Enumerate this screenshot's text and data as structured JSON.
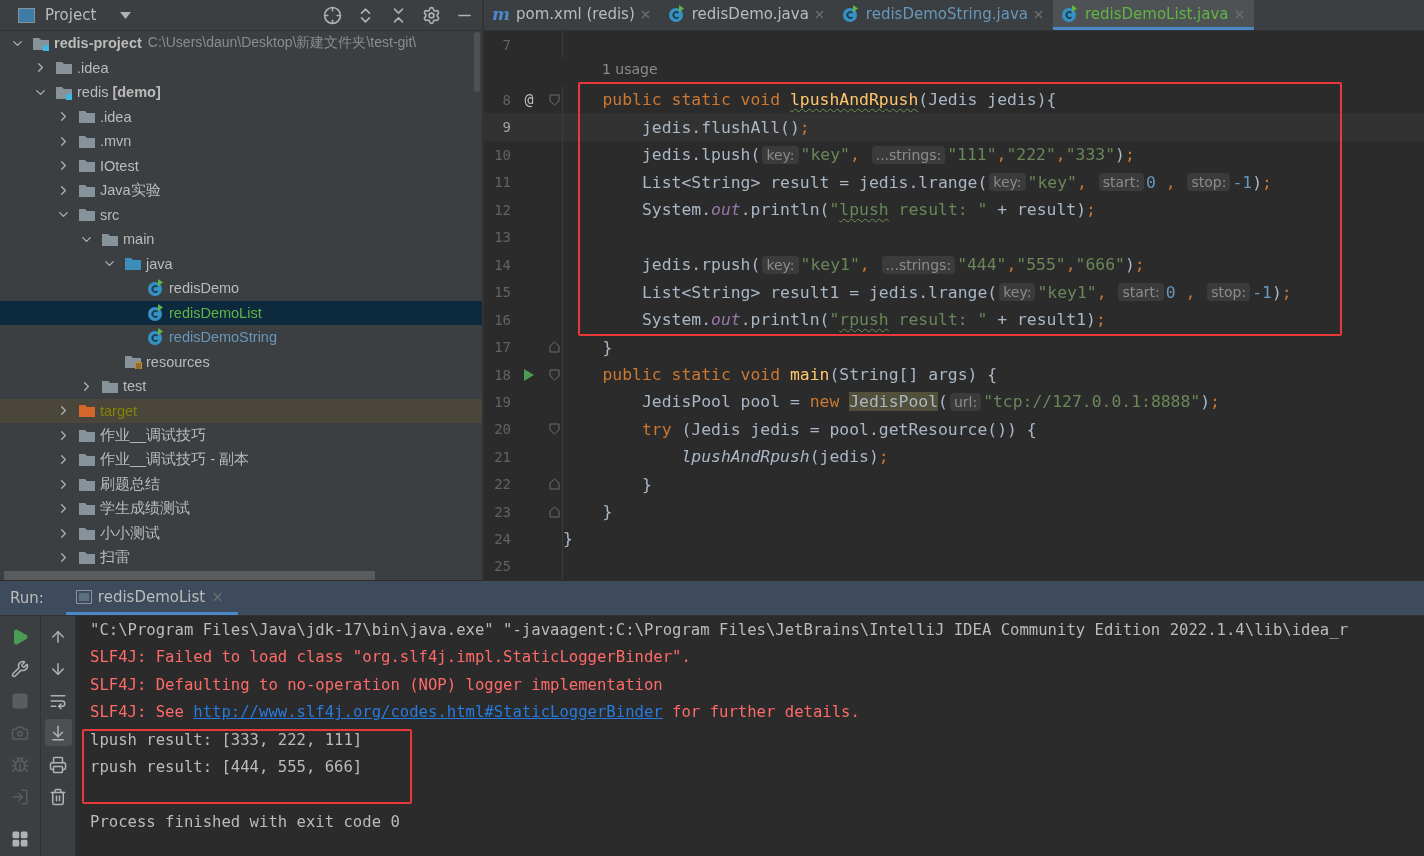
{
  "project_panel": {
    "title": "Project",
    "toolbar": [
      {
        "kind": "locate"
      },
      {
        "kind": "expand"
      },
      {
        "kind": "collapse"
      },
      {
        "kind": "settings"
      },
      {
        "kind": "hide"
      }
    ],
    "tree": [
      {
        "label": "redis-project",
        "kind": "project",
        "path": "C:\\Users\\daun\\Desktop\\新建文件夹\\test-git\\",
        "expanded": true,
        "selected": false,
        "color": "#bbbbbb",
        "children": [
          {
            "label": ".idea",
            "kind": "folder",
            "expanded": false,
            "selected": false,
            "color": "#bbbbbb"
          },
          {
            "label": "redis",
            "tag": "[demo]",
            "kind": "module",
            "expanded": true,
            "selected": false,
            "color": "#bbbbbb",
            "children": [
              {
                "label": ".idea",
                "kind": "folder",
                "expanded": false,
                "selected": false,
                "color": "#bbbbbb"
              },
              {
                "label": ".mvn",
                "kind": "folder",
                "expanded": false,
                "selected": false,
                "color": "#bbbbbb"
              },
              {
                "label": "IOtest",
                "kind": "folder",
                "expanded": false,
                "selected": false,
                "color": "#bbbbbb"
              },
              {
                "label": "Java实验",
                "kind": "folder",
                "expanded": false,
                "selected": false,
                "color": "#bbbbbb"
              },
              {
                "label": "src",
                "kind": "folder",
                "expanded": true,
                "selected": false,
                "color": "#bbbbbb",
                "children": [
                  {
                    "label": "main",
                    "kind": "folder",
                    "expanded": true,
                    "selected": false,
                    "color": "#bbbbbb",
                    "children": [
                      {
                        "label": "java",
                        "kind": "source",
                        "expanded": true,
                        "selected": false,
                        "color": "#bbbbbb",
                        "children": [
                          {
                            "label": "redisDemo",
                            "kind": "class",
                            "selected": false,
                            "color": "#bbbbbb"
                          },
                          {
                            "label": "redisDemoList",
                            "kind": "class",
                            "selected": true,
                            "color": "#62b543"
                          },
                          {
                            "label": "redisDemoString",
                            "kind": "class",
                            "selected": false,
                            "color": "#6897bb"
                          }
                        ]
                      },
                      {
                        "label": "resources",
                        "kind": "resources",
                        "selected": false,
                        "color": "#bbbbbb"
                      }
                    ]
                  },
                  {
                    "label": "test",
                    "kind": "folder",
                    "expanded": false,
                    "selected": false,
                    "color": "#bbbbbb"
                  }
                ]
              },
              {
                "label": "target",
                "kind": "excluded",
                "expanded": false,
                "selected": false,
                "color": "#848504"
              },
              {
                "label": "作业__调试技巧",
                "kind": "folder",
                "expanded": false,
                "selected": false,
                "color": "#bbbbbb"
              },
              {
                "label": "作业__调试技巧 - 副本",
                "kind": "folder",
                "expanded": false,
                "selected": false,
                "color": "#bbbbbb"
              },
              {
                "label": "刷题总结",
                "kind": "folder",
                "expanded": false,
                "selected": false,
                "color": "#bbbbbb"
              },
              {
                "label": "学生成绩测试",
                "kind": "folder",
                "expanded": false,
                "selected": false,
                "color": "#bbbbbb"
              },
              {
                "label": "小小测试",
                "kind": "folder",
                "expanded": false,
                "selected": false,
                "color": "#bbbbbb"
              },
              {
                "label": "扫雷",
                "kind": "folder",
                "expanded": false,
                "selected": false,
                "color": "#bbbbbb"
              }
            ]
          }
        ]
      }
    ]
  },
  "editor": {
    "tabs": [
      {
        "label": "pom.xml (redis)",
        "kind": "maven",
        "glyph": "m",
        "selected": false,
        "color": "#bbbbbb"
      },
      {
        "label": "redisDemo.java",
        "kind": "class",
        "selected": false,
        "color": "#bbbbbb"
      },
      {
        "label": "redisDemoString.java",
        "kind": "class",
        "selected": false,
        "color": "#6897bb"
      },
      {
        "label": "redisDemoList.java",
        "kind": "class",
        "selected": true,
        "color": "#62b543"
      }
    ],
    "lines": [
      {
        "number": "7",
        "current": false,
        "boxed": false
      },
      {
        "number": "8",
        "current": false,
        "boxed": true,
        "usage": "1 usage",
        "gutter": {
          "kind": "override",
          "glyph": "@"
        },
        "fold": {
          "kind": "open"
        },
        "tokens": [
          {
            "kind": "kw",
            "text": "    public static void "
          },
          {
            "kind": "decl",
            "text": "lpushAndRpush",
            "squiggle": true
          },
          {
            "kind": "plain",
            "text": "(Jedis jedis){"
          }
        ]
      },
      {
        "number": "9",
        "current": true,
        "boxed": true,
        "tokens": [
          {
            "kind": "plain",
            "text": "        jedis.flushAll()"
          },
          {
            "kind": "semi",
            "text": ";"
          }
        ]
      },
      {
        "number": "10",
        "current": false,
        "boxed": true,
        "tokens": [
          {
            "kind": "plain",
            "text": "        jedis.lpush("
          },
          {
            "kind": "hint",
            "text": "key:"
          },
          {
            "kind": "str",
            "text": "\"key\""
          },
          {
            "kind": "semi",
            "text": ", "
          },
          {
            "kind": "hint",
            "text": "...strings:"
          },
          {
            "kind": "str",
            "text": "\"111\""
          },
          {
            "kind": "semi",
            "text": ","
          },
          {
            "kind": "str",
            "text": "\"222\""
          },
          {
            "kind": "semi",
            "text": ","
          },
          {
            "kind": "str",
            "text": "\"333\""
          },
          {
            "kind": "plain",
            "text": ")"
          },
          {
            "kind": "semi",
            "text": ";"
          }
        ]
      },
      {
        "number": "11",
        "current": false,
        "boxed": true,
        "tokens": [
          {
            "kind": "plain",
            "text": "        List<String> result = jedis.lrange("
          },
          {
            "kind": "hint",
            "text": "key:"
          },
          {
            "kind": "str",
            "text": "\"key\""
          },
          {
            "kind": "semi",
            "text": ", "
          },
          {
            "kind": "hint",
            "text": "start:"
          },
          {
            "kind": "num",
            "text": "0"
          },
          {
            "kind": "semi",
            "text": " , "
          },
          {
            "kind": "hint",
            "text": "stop:"
          },
          {
            "kind": "num",
            "text": "-1"
          },
          {
            "kind": "plain",
            "text": ")"
          },
          {
            "kind": "semi",
            "text": ";"
          }
        ]
      },
      {
        "number": "12",
        "current": false,
        "boxed": true,
        "tokens": [
          {
            "kind": "plain",
            "text": "        System."
          },
          {
            "kind": "field",
            "text": "out"
          },
          {
            "kind": "plain",
            "text": ".println("
          },
          {
            "kind": "str",
            "text": "\""
          },
          {
            "kind": "str",
            "text": "lpush",
            "squiggle": true
          },
          {
            "kind": "str",
            "text": " result: \""
          },
          {
            "kind": "plain",
            "text": " + result)"
          },
          {
            "kind": "semi",
            "text": ";"
          }
        ]
      },
      {
        "number": "13",
        "current": false,
        "boxed": true
      },
      {
        "number": "14",
        "current": false,
        "boxed": true,
        "tokens": [
          {
            "kind": "plain",
            "text": "        jedis.rpush("
          },
          {
            "kind": "hint",
            "text": "key:"
          },
          {
            "kind": "str",
            "text": "\"key1\""
          },
          {
            "kind": "semi",
            "text": ", "
          },
          {
            "kind": "hint",
            "text": "...strings:"
          },
          {
            "kind": "str",
            "text": "\"444\""
          },
          {
            "kind": "semi",
            "text": ","
          },
          {
            "kind": "str",
            "text": "\"555\""
          },
          {
            "kind": "semi",
            "text": ","
          },
          {
            "kind": "str",
            "text": "\"666\""
          },
          {
            "kind": "plain",
            "text": ")"
          },
          {
            "kind": "semi",
            "text": ";"
          }
        ]
      },
      {
        "number": "15",
        "current": false,
        "boxed": true,
        "tokens": [
          {
            "kind": "plain",
            "text": "        List<String> result1 = jedis.lrange("
          },
          {
            "kind": "hint",
            "text": "key:"
          },
          {
            "kind": "str",
            "text": "\"key1\""
          },
          {
            "kind": "semi",
            "text": ", "
          },
          {
            "kind": "hint",
            "text": "start:"
          },
          {
            "kind": "num",
            "text": "0"
          },
          {
            "kind": "semi",
            "text": " , "
          },
          {
            "kind": "hint",
            "text": "stop:"
          },
          {
            "kind": "num",
            "text": "-1"
          },
          {
            "kind": "plain",
            "text": ")"
          },
          {
            "kind": "semi",
            "text": ";"
          }
        ]
      },
      {
        "number": "16",
        "current": false,
        "boxed": true,
        "tokens": [
          {
            "kind": "plain",
            "text": "        System."
          },
          {
            "kind": "field",
            "text": "out"
          },
          {
            "kind": "plain",
            "text": ".println("
          },
          {
            "kind": "str",
            "text": "\""
          },
          {
            "kind": "str",
            "text": "rpush",
            "squiggle": true
          },
          {
            "kind": "str",
            "text": " result: \""
          },
          {
            "kind": "plain",
            "text": " + result1)"
          },
          {
            "kind": "semi",
            "text": ";"
          }
        ]
      },
      {
        "number": "17",
        "current": false,
        "boxed": false,
        "fold": {
          "kind": "close"
        },
        "tokens": [
          {
            "kind": "plain",
            "text": "    }"
          }
        ]
      },
      {
        "number": "18",
        "current": false,
        "boxed": false,
        "gutter": {
          "kind": "run"
        },
        "fold": {
          "kind": "open"
        },
        "tokens": [
          {
            "kind": "kw",
            "text": "    public static void "
          },
          {
            "kind": "decl",
            "text": "main"
          },
          {
            "kind": "plain",
            "text": "(String[] args) {"
          }
        ]
      },
      {
        "number": "19",
        "current": false,
        "boxed": false,
        "tokens": [
          {
            "kind": "plain",
            "text": "        JedisPool pool = "
          },
          {
            "kind": "kw",
            "text": "new "
          },
          {
            "kind": "match",
            "text": "JedisPool"
          },
          {
            "kind": "plain",
            "text": "("
          },
          {
            "kind": "hint",
            "text": "url:"
          },
          {
            "kind": "str",
            "text": "\"tcp://127.0.0.1:8888\""
          },
          {
            "kind": "plain",
            "text": ")"
          },
          {
            "kind": "semi",
            "text": ";"
          }
        ]
      },
      {
        "number": "20",
        "current": false,
        "boxed": false,
        "fold": {
          "kind": "open"
        },
        "tokens": [
          {
            "kind": "kw",
            "text": "        try "
          },
          {
            "kind": "plain",
            "text": "(Jedis jedis = pool.getResource()) {"
          }
        ]
      },
      {
        "number": "21",
        "current": false,
        "boxed": false,
        "tokens": [
          {
            "kind": "call",
            "text": "            lpushAndRpush"
          },
          {
            "kind": "plain",
            "text": "(jedis)"
          },
          {
            "kind": "semi",
            "text": ";"
          }
        ]
      },
      {
        "number": "22",
        "current": false,
        "boxed": false,
        "fold": {
          "kind": "close"
        },
        "tokens": [
          {
            "kind": "plain",
            "text": "        }"
          }
        ]
      },
      {
        "number": "23",
        "current": false,
        "boxed": false,
        "fold": {
          "kind": "close"
        },
        "tokens": [
          {
            "kind": "plain",
            "text": "    }"
          }
        ]
      },
      {
        "number": "24",
        "current": false,
        "boxed": false,
        "tokens": [
          {
            "kind": "plain",
            "text": "}"
          }
        ]
      },
      {
        "number": "25",
        "current": false,
        "boxed": false
      }
    ]
  },
  "run_panel": {
    "label": "Run:",
    "tabs": [
      {
        "label": "redisDemoList",
        "close": "×",
        "selected": true
      }
    ],
    "toolbar_left": [
      {
        "kind": "run",
        "disabled": false
      },
      {
        "kind": "wrench",
        "disabled": false
      },
      {
        "kind": "stop",
        "disabled": true
      },
      {
        "kind": "camera",
        "disabled": true
      },
      {
        "kind": "bug",
        "disabled": true
      },
      {
        "kind": "exit",
        "disabled": true
      },
      {
        "kind": "layout",
        "disabled": false
      }
    ],
    "toolbar_right": [
      {
        "kind": "up",
        "selected": false
      },
      {
        "kind": "down",
        "selected": false
      },
      {
        "kind": "wrap",
        "selected": false
      },
      {
        "kind": "scroll",
        "selected": true
      },
      {
        "kind": "print",
        "selected": false
      },
      {
        "kind": "trash",
        "selected": false
      }
    ],
    "console": [
      {
        "kind": "command",
        "boxed": false,
        "segments": [
          {
            "text": "\"C:\\Program Files\\Java\\jdk-17\\bin\\java.exe\" \"-javaagent:C:\\Program Files\\JetBrains\\IntelliJ IDEA Community Edition 2022.1.4\\lib\\idea_r",
            "link": false
          }
        ]
      },
      {
        "kind": "error",
        "boxed": false,
        "segments": [
          {
            "text": "SLF4J: Failed to load class \"org.slf4j.impl.StaticLoggerBinder\".",
            "link": false
          }
        ]
      },
      {
        "kind": "error",
        "boxed": false,
        "segments": [
          {
            "text": "SLF4J: Defaulting to no-operation (NOP) logger implementation",
            "link": false
          }
        ]
      },
      {
        "kind": "error",
        "boxed": false,
        "segments": [
          {
            "text": "SLF4J: See ",
            "link": false
          },
          {
            "text": "http://www.slf4j.org/codes.html#StaticLoggerBinder",
            "link": true
          },
          {
            "text": " for further details.",
            "link": false
          }
        ]
      },
      {
        "kind": "output",
        "boxed": true,
        "segments": [
          {
            "text": "lpush result: [333, 222, 111]",
            "link": false
          }
        ]
      },
      {
        "kind": "output",
        "boxed": true,
        "segments": [
          {
            "text": "rpush result: [444, 555, 666]",
            "link": false
          }
        ]
      },
      {
        "kind": "output",
        "boxed": false,
        "segments": [
          {
            "text": "Process finished with exit code 0",
            "link": false
          }
        ]
      }
    ]
  }
}
